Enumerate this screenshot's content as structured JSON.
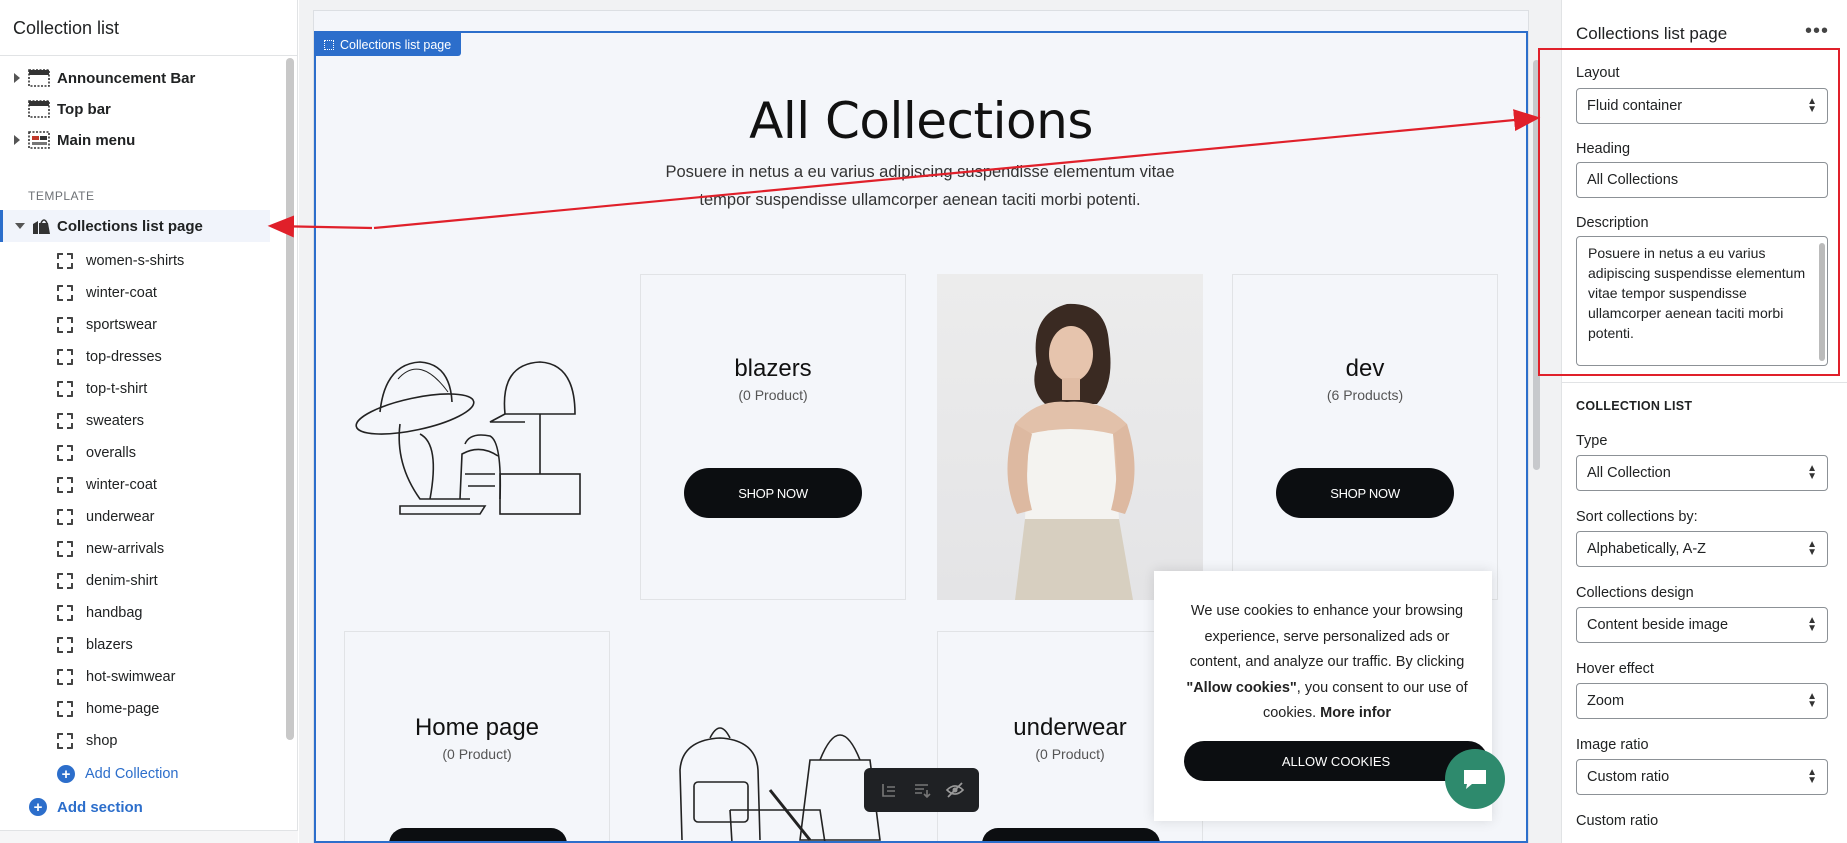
{
  "left_panel": {
    "title": "Collection list",
    "sections": [
      {
        "label": "Announcement Bar",
        "expandable": true,
        "icon": "announcement-bar-icon"
      },
      {
        "label": "Top bar",
        "expandable": false,
        "icon": "top-bar-icon"
      },
      {
        "label": "Main menu",
        "expandable": true,
        "icon": "main-menu-icon"
      }
    ],
    "template_label": "TEMPLATE",
    "template_page": "Collections list page",
    "blocks": [
      "women-s-shirts",
      "winter-coat",
      "sportswear",
      "top-dresses",
      "top-t-shirt",
      "sweaters",
      "overalls",
      "winter-coat",
      "underwear",
      "new-arrivals",
      "denim-shirt",
      "handbag",
      "blazers",
      "hot-swimwear",
      "home-page",
      "shop"
    ],
    "add_collection": "Add Collection",
    "add_section": "Add section"
  },
  "preview": {
    "section_tag": "Collections list page",
    "heading": "All Collections",
    "description": "Posuere in netus a eu varius adipiscing suspendisse elementum vitae tempor suspendisse ullamcorper aenean taciti morbi potenti.",
    "cards": [
      {
        "name": "blazers",
        "count": "(0 Product)",
        "button": "SHOP NOW"
      },
      {
        "name": "dev",
        "count": "(6 Products)",
        "button": "SHOP NOW"
      },
      {
        "name": "Home page",
        "count": "(0 Product)"
      },
      {
        "name": "underwear",
        "count": "(0 Product)"
      }
    ],
    "cookie": {
      "text_before": "We use cookies to enhance your browsing experience, serve personalized ads or content, and analyze our traffic. By clicking ",
      "allow_quote": "\"Allow cookies\"",
      "text_middle": ", you consent to our use of cookies. ",
      "more_info": "More infor",
      "button": "ALLOW COOKIES"
    }
  },
  "right_panel": {
    "title": "Collections list page",
    "layout_label": "Layout",
    "layout_value": "Fluid container",
    "heading_label": "Heading",
    "heading_value": "All Collections",
    "description_label": "Description",
    "description_value": "Posuere in netus a eu varius adipiscing suspendisse elementum vitae tempor suspendisse\nullamcorper aenean taciti morbi potenti.",
    "collection_list_header": "COLLECTION LIST",
    "type_label": "Type",
    "type_value": "All Collection",
    "sort_label": "Sort collections by:",
    "sort_value": "Alphabetically, A-Z",
    "design_label": "Collections design",
    "design_value": "Content beside image",
    "hover_label": "Hover effect",
    "hover_value": "Zoom",
    "ratio_label": "Image ratio",
    "ratio_value": "Custom ratio",
    "custom_ratio_label": "Custom ratio"
  },
  "colors": {
    "accent": "#2c6ecb",
    "annotation": "#e0202a",
    "button_dark": "#0c0e11",
    "chat": "#2e8a6d"
  }
}
